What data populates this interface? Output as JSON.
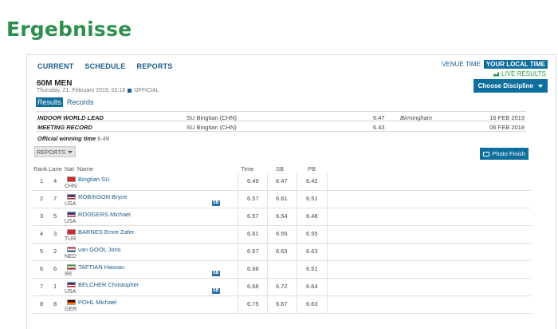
{
  "page": {
    "heading": "Ergebnisse"
  },
  "nav": {
    "items": [
      "CURRENT",
      "SCHEDULE",
      "REPORTS"
    ]
  },
  "time_toggle": {
    "venue": "VENUE TIME",
    "local": "YOUR LOCAL TIME"
  },
  "live_results": "LIVE RESULTS",
  "choose_discipline": "Choose Discipline",
  "event": {
    "title": "60M MEN",
    "datetime": "Thursday, 21. February 2019, 02:18",
    "status": "OFFICIAL"
  },
  "tabs": {
    "results": "Results",
    "records": "Records"
  },
  "records": [
    {
      "label": "INDOOR WORLD LEAD",
      "athlete": "SU Bingtian (CHN)",
      "mark": "6.47",
      "venue": "Birmingham",
      "date": "16 FEB 2019"
    },
    {
      "label": "MEETING RECORD",
      "athlete": "SU Bingtian (CHN)",
      "mark": "6.43",
      "venue": "",
      "date": "06 FEB 2018"
    }
  ],
  "winning_time": {
    "label": "Official winning time",
    "value": "6.49"
  },
  "reports_dropdown": "REPORTS",
  "photo_finish": "Photo Finish",
  "table": {
    "headers": {
      "rank": "Rank",
      "lane": "Lane",
      "nat": "Nat",
      "name": "Name",
      "time": "Time",
      "sb": "SB",
      "pb": "PB"
    },
    "rows": [
      {
        "rank": "1",
        "lane": "4",
        "nat": "CHN",
        "name": "Bingtian SU",
        "time": "6.49",
        "sb": "6.47",
        "pb": "6.42",
        "tag": ""
      },
      {
        "rank": "2",
        "lane": "7",
        "nat": "USA",
        "name": "ROBINSON Bryce",
        "time": "6.57",
        "sb": "6.61",
        "pb": "6.51",
        "tag": "SB"
      },
      {
        "rank": "3",
        "lane": "5",
        "nat": "USA",
        "name": "RODGERS Michael",
        "time": "6.57",
        "sb": "6.54",
        "pb": "6.48",
        "tag": ""
      },
      {
        "rank": "4",
        "lane": "3",
        "nat": "TUR",
        "name": "BARNES Emre Zafer",
        "time": "6.61",
        "sb": "6.55",
        "pb": "6.55",
        "tag": ""
      },
      {
        "rank": "5",
        "lane": "2",
        "nat": "NED",
        "name": "van GOOL Joris",
        "time": "6.67",
        "sb": "6.63",
        "pb": "6.63",
        "tag": ""
      },
      {
        "rank": "6",
        "lane": "6",
        "nat": "IRI",
        "name": "TAFTIAN Hassan",
        "time": "6.68",
        "sb": "",
        "pb": "6.51",
        "tag": "SB"
      },
      {
        "rank": "7",
        "lane": "1",
        "nat": "USA",
        "name": "BELCHER Christopher",
        "time": "6.68",
        "sb": "6.72",
        "pb": "6.64",
        "tag": "SB"
      },
      {
        "rank": "8",
        "lane": "8",
        "nat": "GER",
        "name": "POHL Michael",
        "time": "6.75",
        "sb": "6.67",
        "pb": "6.63",
        "tag": ""
      }
    ]
  },
  "colors": {
    "brand_green": "#2d8f4e",
    "accent_blue": "#0e6e9e",
    "link_blue": "#1a5a8a",
    "live_green": "#2c9a4c"
  }
}
